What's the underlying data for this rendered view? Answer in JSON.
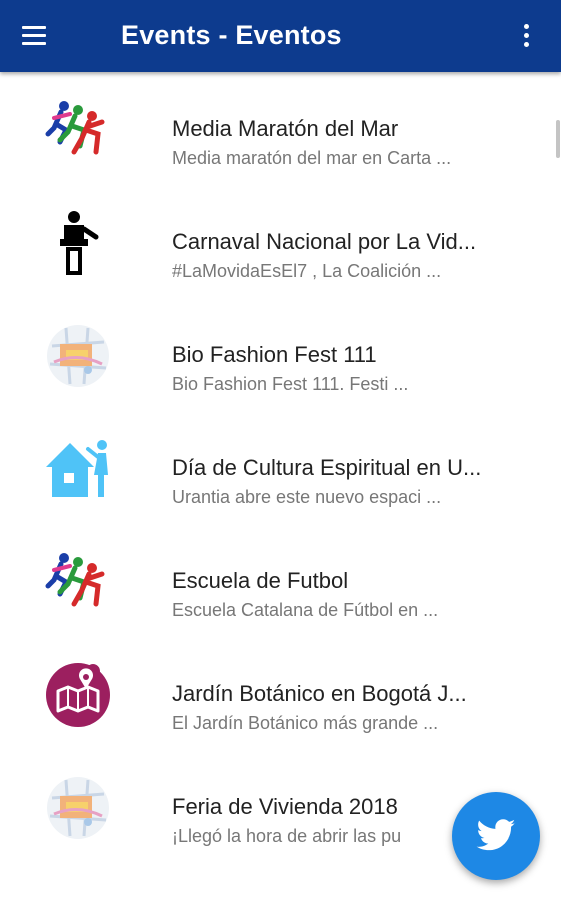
{
  "app_bar": {
    "title": "Events - Eventos",
    "menu_icon": "hamburger-menu-icon",
    "overflow_icon": "more-vert-icon",
    "color": "#0d3b8e"
  },
  "events": [
    {
      "title": "Media Maratón del Mar",
      "subtitle": "Media maratón del mar en Carta ...",
      "icon": "runners-icon"
    },
    {
      "title": "Carnaval Nacional por La Vid...",
      "subtitle": "#LaMovidaEsEl7 , La Coalición ...",
      "icon": "speaker-podium-icon"
    },
    {
      "title": "Bio Fashion Fest 111",
      "subtitle": "Bio Fashion Fest 111. Festi ...",
      "icon": "city-map-icon"
    },
    {
      "title": "Día de Cultura Espiritual en U...",
      "subtitle": "Urantia abre este nuevo espaci ...",
      "icon": "house-person-icon"
    },
    {
      "title": "Escuela de Futbol",
      "subtitle": "Escuela Catalana de Fútbol en  ...",
      "icon": "runners-icon"
    },
    {
      "title": "Jardín Botánico en Bogotá J...",
      "subtitle": "El Jardín Botánico más grande ...",
      "icon": "map-pin-icon"
    },
    {
      "title": "Feria de Vivienda 2018",
      "subtitle": "¡Llegó la hora de abrir las pu",
      "icon": "city-map-icon"
    }
  ],
  "fab": {
    "icon": "twitter-icon",
    "color": "#1e88e5"
  }
}
